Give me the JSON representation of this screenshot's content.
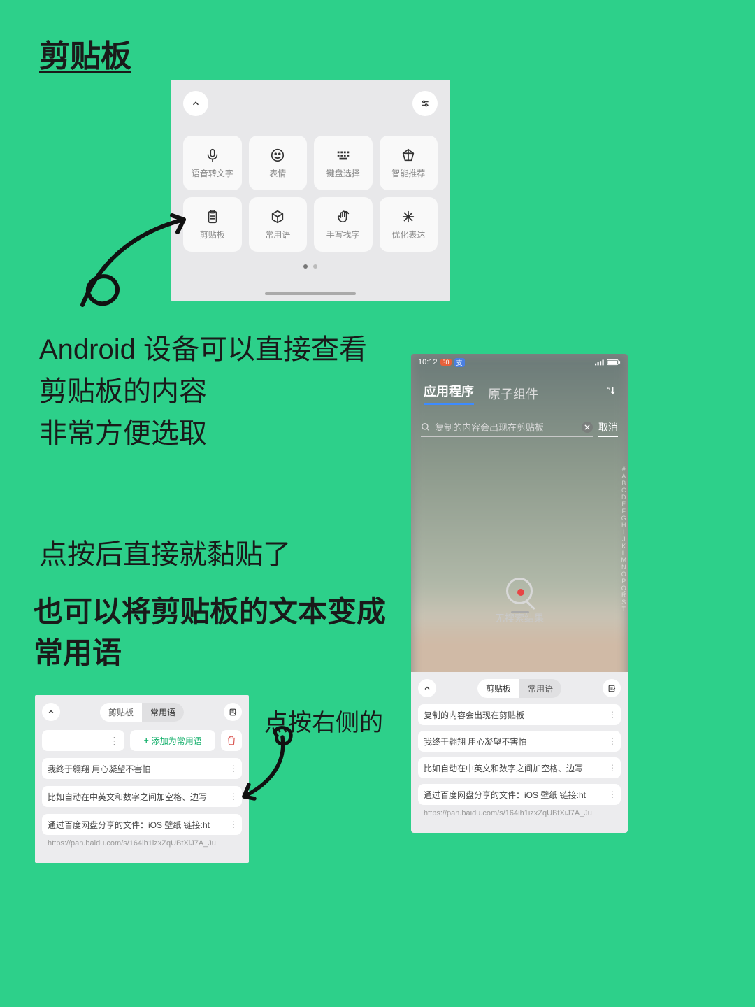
{
  "title": "剪贴板",
  "panel1": {
    "tiles": [
      {
        "name": "voice-to-text-tile",
        "label": "语音转文字",
        "icon": "mic-icon"
      },
      {
        "name": "emoji-tile",
        "label": "表情",
        "icon": "smile-icon"
      },
      {
        "name": "keyboard-select-tile",
        "label": "键盘选择",
        "icon": "keyboard-icon"
      },
      {
        "name": "smart-suggest-tile",
        "label": "智能推荐",
        "icon": "diamond-icon"
      },
      {
        "name": "clipboard-tile",
        "label": "剪贴板",
        "icon": "clipboard-icon"
      },
      {
        "name": "phrases-tile",
        "label": "常用语",
        "icon": "cube-icon"
      },
      {
        "name": "handwrite-tile",
        "label": "手写找字",
        "icon": "hand-icon"
      },
      {
        "name": "optimize-tile",
        "label": "优化表达",
        "icon": "sparkle-icon"
      }
    ]
  },
  "text1_l1": "Android 设备可以直接查看",
  "text1_l2": "剪贴板的内容",
  "text1_l3": "非常方便选取",
  "text2": "点按后直接就黏贴了",
  "text3_l1": "也可以将剪贴板的文本变成",
  "text3_l2": "常用语",
  "text4": "点按右侧的",
  "panel2": {
    "tab_clipboard": "剪贴板",
    "tab_phrases": "常用语",
    "add_label": "添加为常用语",
    "items": [
      "我终于翱翔 用心凝望不害怕",
      "比如自动在中英文和数字之间加空格、边写",
      "通过百度网盘分享的文件：iOS 壁纸 链接:ht"
    ],
    "last": "https://pan.baidu.com/s/164ih1izxZqUBtXiJ7A_Ju"
  },
  "panel3": {
    "time": "10:12",
    "tab_apps": "应用程序",
    "tab_atoms": "原子组件",
    "search_text": "复制的内容会出现在剪贴板",
    "cancel": "取消",
    "no_result": "无搜索结果",
    "alpha": [
      "#",
      "A",
      "B",
      "C",
      "D",
      "E",
      "F",
      "G",
      "H",
      "I",
      "J",
      "K",
      "L",
      "M",
      "N",
      "O",
      "P",
      "Q",
      "R",
      "S",
      "T"
    ],
    "sheet": {
      "tab_clipboard": "剪贴板",
      "tab_phrases": "常用语",
      "items": [
        "复制的内容会出现在剪贴板",
        "我终于翱翔 用心凝望不害怕",
        "比如自动在中英文和数字之间加空格、边写",
        "通过百度网盘分享的文件：iOS 壁纸 链接:ht"
      ],
      "last": "https://pan.baidu.com/s/164ih1izxZqUBtXiJ7A_Ju"
    }
  }
}
